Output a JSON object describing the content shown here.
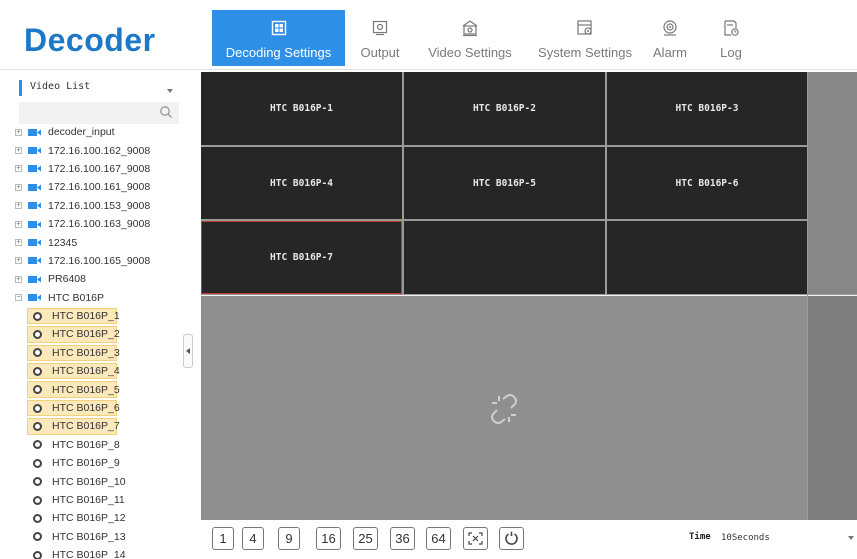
{
  "app": {
    "logo": "Decoder"
  },
  "nav": {
    "items": [
      {
        "label": "Decoding Settings",
        "icon": "decoding-settings-icon",
        "active": true
      },
      {
        "label": "Output",
        "icon": "output-icon",
        "active": false
      },
      {
        "label": "Video Settings",
        "icon": "video-settings-icon",
        "active": false
      },
      {
        "label": "System Settings",
        "icon": "system-settings-icon",
        "active": false
      },
      {
        "label": "Alarm",
        "icon": "alarm-icon",
        "active": false
      },
      {
        "label": "Log",
        "icon": "log-icon",
        "active": false
      }
    ]
  },
  "sidebar": {
    "title": "Video List",
    "search_placeholder": "",
    "groups": [
      {
        "label": "decoder_input",
        "expander": "+"
      },
      {
        "label": "172.16.100.162_9008",
        "expander": "+"
      },
      {
        "label": "172.16.100.167_9008",
        "expander": "+"
      },
      {
        "label": "172.16.100.161_9008",
        "expander": "+"
      },
      {
        "label": "172.16.100.153_9008",
        "expander": "+"
      },
      {
        "label": "172.16.100.163_9008",
        "expander": "+"
      },
      {
        "label": "12345",
        "expander": "+"
      },
      {
        "label": "172.16.100.165_9008",
        "expander": "+"
      },
      {
        "label": "PR6408",
        "expander": "+"
      },
      {
        "label": "HTC B016P",
        "expander": "−"
      }
    ],
    "children": [
      {
        "label": "HTC B016P_1",
        "selected": true
      },
      {
        "label": "HTC B016P_2",
        "selected": true
      },
      {
        "label": "HTC B016P_3",
        "selected": true
      },
      {
        "label": "HTC B016P_4",
        "selected": true
      },
      {
        "label": "HTC B016P_5",
        "selected": true
      },
      {
        "label": "HTC B016P_6",
        "selected": true
      },
      {
        "label": "HTC B016P_7",
        "selected": true
      },
      {
        "label": "HTC B016P_8",
        "selected": false
      },
      {
        "label": "HTC B016P_9",
        "selected": false
      },
      {
        "label": "HTC B016P_10",
        "selected": false
      },
      {
        "label": "HTC B016P_11",
        "selected": false
      },
      {
        "label": "HTC B016P_12",
        "selected": false
      },
      {
        "label": "HTC B016P_13",
        "selected": false
      },
      {
        "label": "HTC B016P_14",
        "selected": false
      }
    ]
  },
  "video": {
    "tiles": [
      "HTC B016P-1",
      "HTC B016P-2",
      "HTC B016P-3",
      "HTC B016P-4",
      "HTC B016P-5",
      "HTC B016P-6",
      "HTC B016P-7",
      "",
      ""
    ],
    "selected_tile_index": 6
  },
  "toolbar": {
    "layouts": [
      "1",
      "4",
      "9",
      "16",
      "25",
      "36",
      "64"
    ],
    "fullscreen_icon": "fullscreen-icon",
    "refresh_icon": "refresh-icon",
    "time_label": "Time",
    "time_value": "10Seconds"
  },
  "colors": {
    "accent": "#2e8fe6",
    "logo": "#1e78c8",
    "tile_bg": "#262626",
    "selected_item_bg": "#fbe9bb",
    "selected_tile_border": "#c0392b"
  }
}
